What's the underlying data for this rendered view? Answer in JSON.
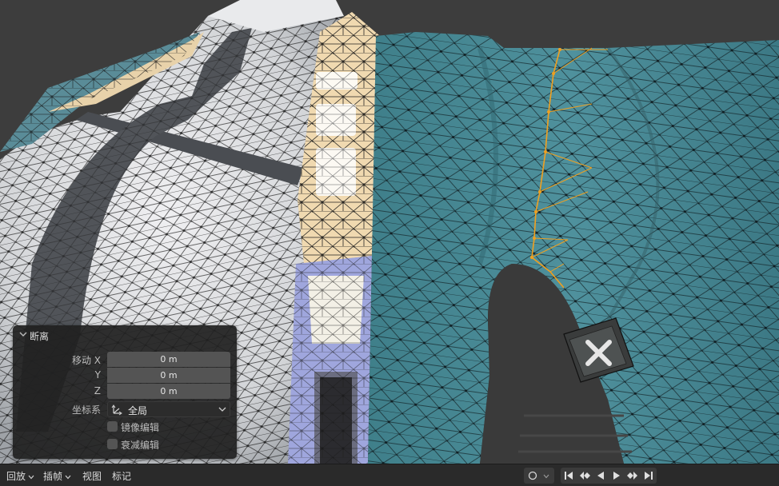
{
  "operator_panel": {
    "title": "断离",
    "move_label": "移动 X",
    "y_label": "Y",
    "z_label": "Z",
    "x_value": "0 m",
    "y_value": "0 m",
    "z_value": "0 m",
    "coord_label": "坐标系",
    "coord_value": "全局",
    "mirror_label": "镜像编辑",
    "falloff_label": "衰减编辑",
    "mirror_checked": false,
    "falloff_checked": false
  },
  "bottom_bar": {
    "playback": "回放",
    "keying": "插帧",
    "view": "视图",
    "marker": "标记"
  },
  "icons": {
    "collapse": "chevron-down-icon",
    "coord_system": "orientation-global-icon",
    "keyframe_record": "record-icon",
    "jump_start": "jump-to-start-icon",
    "prev_keyframe": "prev-keyframe-icon",
    "play_reverse": "play-reverse-icon",
    "play": "play-icon",
    "next_keyframe": "next-keyframe-icon",
    "jump_end": "jump-to-end-icon"
  },
  "colors": {
    "selection_edge": "#f0a020",
    "mesh_teal": "#4b8a96",
    "mesh_white": "#cfd1d4",
    "panel_bg": "#202020"
  }
}
